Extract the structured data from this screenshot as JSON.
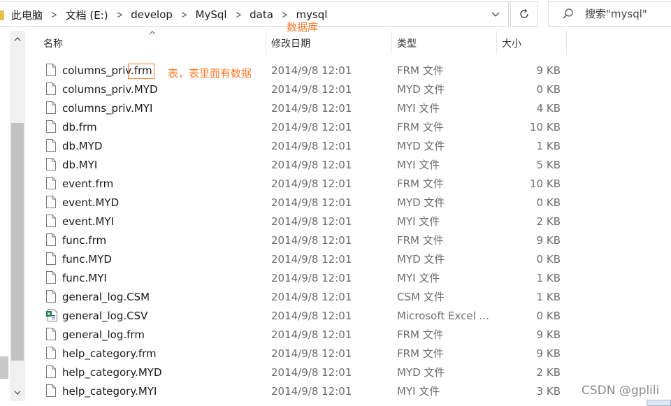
{
  "breadcrumb": [
    "此电脑",
    "文档 (E:)",
    "develop",
    "MySql",
    "data",
    "mysql"
  ],
  "search": {
    "placeholder": "搜索\"mysql\""
  },
  "columns": {
    "name": "名称",
    "date": "修改日期",
    "type": "类型",
    "size": "大小"
  },
  "annotations": {
    "database_label": "数据库",
    "table_label": "表，表里面有数据"
  },
  "watermark": "CSDN @gplili",
  "files": [
    {
      "name": "columns_priv.frm",
      "date": "2014/9/8 12:01",
      "type": "FRM 文件",
      "size": "9 KB",
      "icon": "file-icon"
    },
    {
      "name": "columns_priv.MYD",
      "date": "2014/9/8 12:01",
      "type": "MYD 文件",
      "size": "0 KB",
      "icon": "file-icon"
    },
    {
      "name": "columns_priv.MYI",
      "date": "2014/9/8 12:01",
      "type": "MYI 文件",
      "size": "4 KB",
      "icon": "file-icon"
    },
    {
      "name": "db.frm",
      "date": "2014/9/8 12:01",
      "type": "FRM 文件",
      "size": "10 KB",
      "icon": "file-icon"
    },
    {
      "name": "db.MYD",
      "date": "2014/9/8 12:01",
      "type": "MYD 文件",
      "size": "1 KB",
      "icon": "file-icon"
    },
    {
      "name": "db.MYI",
      "date": "2014/9/8 12:01",
      "type": "MYI 文件",
      "size": "5 KB",
      "icon": "file-icon"
    },
    {
      "name": "event.frm",
      "date": "2014/9/8 12:01",
      "type": "FRM 文件",
      "size": "10 KB",
      "icon": "file-icon"
    },
    {
      "name": "event.MYD",
      "date": "2014/9/8 12:01",
      "type": "MYD 文件",
      "size": "0 KB",
      "icon": "file-icon"
    },
    {
      "name": "event.MYI",
      "date": "2014/9/8 12:01",
      "type": "MYI 文件",
      "size": "2 KB",
      "icon": "file-icon"
    },
    {
      "name": "func.frm",
      "date": "2014/9/8 12:01",
      "type": "FRM 文件",
      "size": "9 KB",
      "icon": "file-icon"
    },
    {
      "name": "func.MYD",
      "date": "2014/9/8 12:01",
      "type": "MYD 文件",
      "size": "0 KB",
      "icon": "file-icon"
    },
    {
      "name": "func.MYI",
      "date": "2014/9/8 12:01",
      "type": "MYI 文件",
      "size": "1 KB",
      "icon": "file-icon"
    },
    {
      "name": "general_log.CSM",
      "date": "2014/9/8 12:01",
      "type": "CSM 文件",
      "size": "1 KB",
      "icon": "file-icon"
    },
    {
      "name": "general_log.CSV",
      "date": "2014/9/8 12:01",
      "type": "Microsoft Excel ...",
      "size": "0 KB",
      "icon": "excel-csv-icon"
    },
    {
      "name": "general_log.frm",
      "date": "2014/9/8 12:01",
      "type": "FRM 文件",
      "size": "9 KB",
      "icon": "file-icon"
    },
    {
      "name": "help_category.frm",
      "date": "2014/9/8 12:01",
      "type": "FRM 文件",
      "size": "9 KB",
      "icon": "file-icon"
    },
    {
      "name": "help_category.MYD",
      "date": "2014/9/8 12:01",
      "type": "MYD 文件",
      "size": "2 KB",
      "icon": "file-icon"
    },
    {
      "name": "help_category.MYI",
      "date": "2014/9/8 12:01",
      "type": "MYI 文件",
      "size": "3 KB",
      "icon": "file-icon"
    }
  ]
}
